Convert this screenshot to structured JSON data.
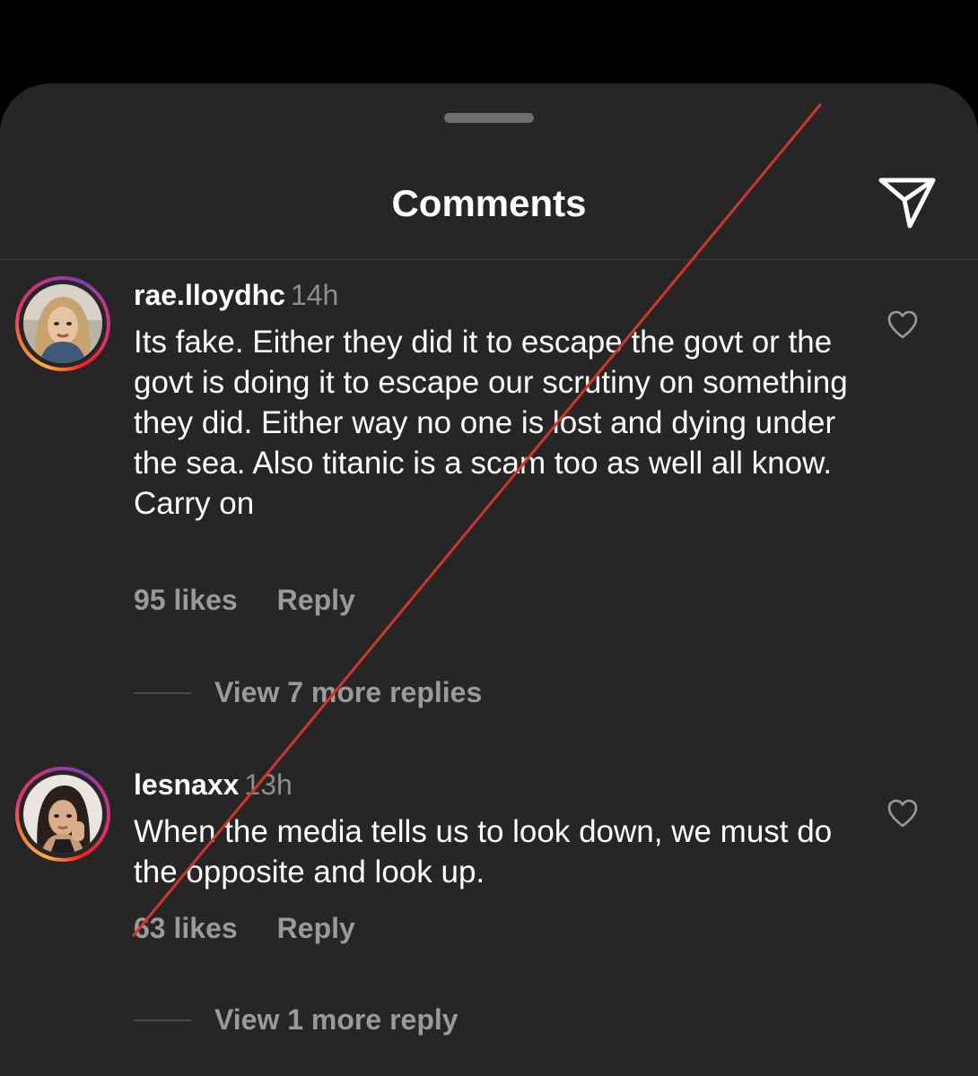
{
  "header": {
    "title": "Comments",
    "share_icon": "paper-plane-icon"
  },
  "comments": [
    {
      "username": "rae.lloydhc",
      "time": "14h",
      "text": "Its fake. Either they did it to escape the govt or the govt is doing it to escape our scrutiny on something they did. Either way no one is lost and dying under the sea. Also titanic is a scam too as well all know. Carry on",
      "likes": "95 likes",
      "reply_label": "Reply",
      "view_replies": "View 7 more replies",
      "like_icon": "heart-outline-icon"
    },
    {
      "username": "lesnaxx",
      "time": "13h",
      "text": "When the media tells us to look down, we must do the opposite and look up.",
      "likes": "63 likes",
      "reply_label": "Reply",
      "view_replies": "View 1 more reply",
      "like_icon": "heart-outline-icon"
    }
  ],
  "colors": {
    "background": "#000000",
    "sheet": "#262626",
    "primary_text": "#ffffff",
    "secondary_text": "#9a9a9a",
    "annotation_line": "#d0372a"
  }
}
